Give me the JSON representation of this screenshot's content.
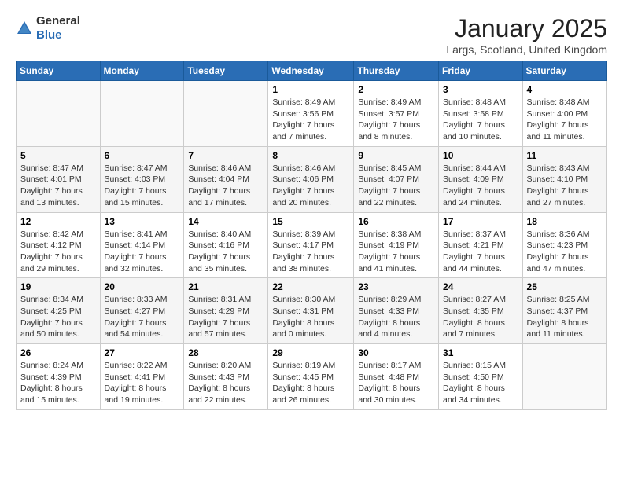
{
  "header": {
    "logo_general": "General",
    "logo_blue": "Blue",
    "month": "January 2025",
    "location": "Largs, Scotland, United Kingdom"
  },
  "days_of_week": [
    "Sunday",
    "Monday",
    "Tuesday",
    "Wednesday",
    "Thursday",
    "Friday",
    "Saturday"
  ],
  "weeks": [
    [
      {
        "day": "",
        "info": ""
      },
      {
        "day": "",
        "info": ""
      },
      {
        "day": "",
        "info": ""
      },
      {
        "day": "1",
        "info": "Sunrise: 8:49 AM\nSunset: 3:56 PM\nDaylight: 7 hours\nand 7 minutes."
      },
      {
        "day": "2",
        "info": "Sunrise: 8:49 AM\nSunset: 3:57 PM\nDaylight: 7 hours\nand 8 minutes."
      },
      {
        "day": "3",
        "info": "Sunrise: 8:48 AM\nSunset: 3:58 PM\nDaylight: 7 hours\nand 10 minutes."
      },
      {
        "day": "4",
        "info": "Sunrise: 8:48 AM\nSunset: 4:00 PM\nDaylight: 7 hours\nand 11 minutes."
      }
    ],
    [
      {
        "day": "5",
        "info": "Sunrise: 8:47 AM\nSunset: 4:01 PM\nDaylight: 7 hours\nand 13 minutes."
      },
      {
        "day": "6",
        "info": "Sunrise: 8:47 AM\nSunset: 4:03 PM\nDaylight: 7 hours\nand 15 minutes."
      },
      {
        "day": "7",
        "info": "Sunrise: 8:46 AM\nSunset: 4:04 PM\nDaylight: 7 hours\nand 17 minutes."
      },
      {
        "day": "8",
        "info": "Sunrise: 8:46 AM\nSunset: 4:06 PM\nDaylight: 7 hours\nand 20 minutes."
      },
      {
        "day": "9",
        "info": "Sunrise: 8:45 AM\nSunset: 4:07 PM\nDaylight: 7 hours\nand 22 minutes."
      },
      {
        "day": "10",
        "info": "Sunrise: 8:44 AM\nSunset: 4:09 PM\nDaylight: 7 hours\nand 24 minutes."
      },
      {
        "day": "11",
        "info": "Sunrise: 8:43 AM\nSunset: 4:10 PM\nDaylight: 7 hours\nand 27 minutes."
      }
    ],
    [
      {
        "day": "12",
        "info": "Sunrise: 8:42 AM\nSunset: 4:12 PM\nDaylight: 7 hours\nand 29 minutes."
      },
      {
        "day": "13",
        "info": "Sunrise: 8:41 AM\nSunset: 4:14 PM\nDaylight: 7 hours\nand 32 minutes."
      },
      {
        "day": "14",
        "info": "Sunrise: 8:40 AM\nSunset: 4:16 PM\nDaylight: 7 hours\nand 35 minutes."
      },
      {
        "day": "15",
        "info": "Sunrise: 8:39 AM\nSunset: 4:17 PM\nDaylight: 7 hours\nand 38 minutes."
      },
      {
        "day": "16",
        "info": "Sunrise: 8:38 AM\nSunset: 4:19 PM\nDaylight: 7 hours\nand 41 minutes."
      },
      {
        "day": "17",
        "info": "Sunrise: 8:37 AM\nSunset: 4:21 PM\nDaylight: 7 hours\nand 44 minutes."
      },
      {
        "day": "18",
        "info": "Sunrise: 8:36 AM\nSunset: 4:23 PM\nDaylight: 7 hours\nand 47 minutes."
      }
    ],
    [
      {
        "day": "19",
        "info": "Sunrise: 8:34 AM\nSunset: 4:25 PM\nDaylight: 7 hours\nand 50 minutes."
      },
      {
        "day": "20",
        "info": "Sunrise: 8:33 AM\nSunset: 4:27 PM\nDaylight: 7 hours\nand 54 minutes."
      },
      {
        "day": "21",
        "info": "Sunrise: 8:31 AM\nSunset: 4:29 PM\nDaylight: 7 hours\nand 57 minutes."
      },
      {
        "day": "22",
        "info": "Sunrise: 8:30 AM\nSunset: 4:31 PM\nDaylight: 8 hours\nand 0 minutes."
      },
      {
        "day": "23",
        "info": "Sunrise: 8:29 AM\nSunset: 4:33 PM\nDaylight: 8 hours\nand 4 minutes."
      },
      {
        "day": "24",
        "info": "Sunrise: 8:27 AM\nSunset: 4:35 PM\nDaylight: 8 hours\nand 7 minutes."
      },
      {
        "day": "25",
        "info": "Sunrise: 8:25 AM\nSunset: 4:37 PM\nDaylight: 8 hours\nand 11 minutes."
      }
    ],
    [
      {
        "day": "26",
        "info": "Sunrise: 8:24 AM\nSunset: 4:39 PM\nDaylight: 8 hours\nand 15 minutes."
      },
      {
        "day": "27",
        "info": "Sunrise: 8:22 AM\nSunset: 4:41 PM\nDaylight: 8 hours\nand 19 minutes."
      },
      {
        "day": "28",
        "info": "Sunrise: 8:20 AM\nSunset: 4:43 PM\nDaylight: 8 hours\nand 22 minutes."
      },
      {
        "day": "29",
        "info": "Sunrise: 8:19 AM\nSunset: 4:45 PM\nDaylight: 8 hours\nand 26 minutes."
      },
      {
        "day": "30",
        "info": "Sunrise: 8:17 AM\nSunset: 4:48 PM\nDaylight: 8 hours\nand 30 minutes."
      },
      {
        "day": "31",
        "info": "Sunrise: 8:15 AM\nSunset: 4:50 PM\nDaylight: 8 hours\nand 34 minutes."
      },
      {
        "day": "",
        "info": ""
      }
    ]
  ]
}
